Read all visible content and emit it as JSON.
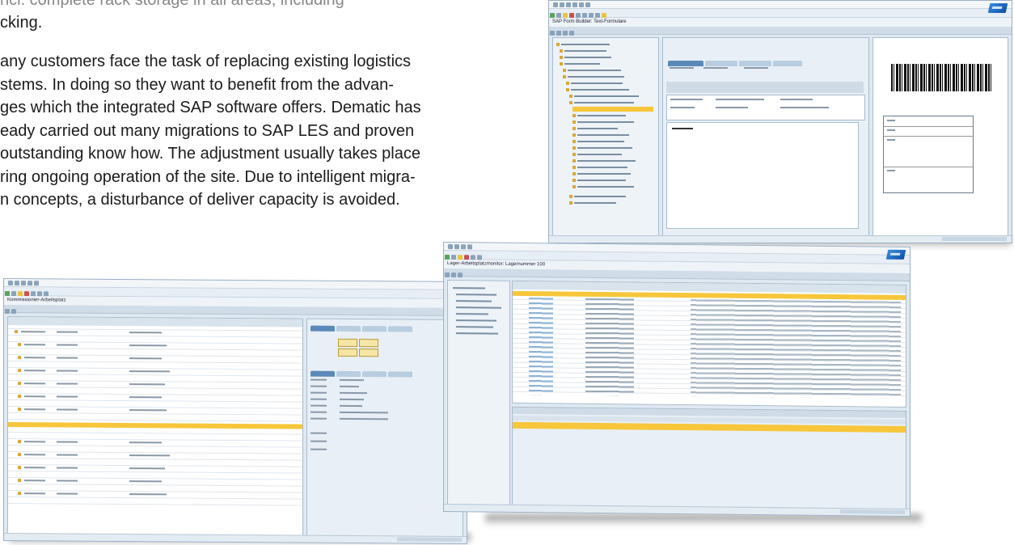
{
  "text": {
    "line_partial": "ncl. complete rack storage in all areas, including",
    "line_2": "cking.",
    "paragraph": [
      "any customers face the task of replacing existing logistics",
      "stems. In doing so they want to benefit from the advan-",
      "ges which the integrated SAP software offers. Dematic has",
      "eady carried out many migrations to SAP LES and proven",
      "outstanding know how. The adjustment usually takes place",
      "ring ongoing operation of the site. Due to intelligent migra-",
      "n concepts, a disturbance of deliver capacity is avoided."
    ]
  },
  "screenshots": {
    "top_right": {
      "title": "SAP Form Builder: Text-Formulare",
      "brand": "SAP"
    },
    "bottom_left": {
      "title": "Kommissionier-Arbeitsplatz",
      "brand": "SAP"
    },
    "bottom_right": {
      "title": "Lager-Arbeitsplatzmonitor: Lagernummer 100",
      "brand": "SAP"
    }
  },
  "colors": {
    "highlight": "#f7c63a",
    "sap_blue": "#0b4fa8",
    "window_bg": "#dfe9f2"
  }
}
